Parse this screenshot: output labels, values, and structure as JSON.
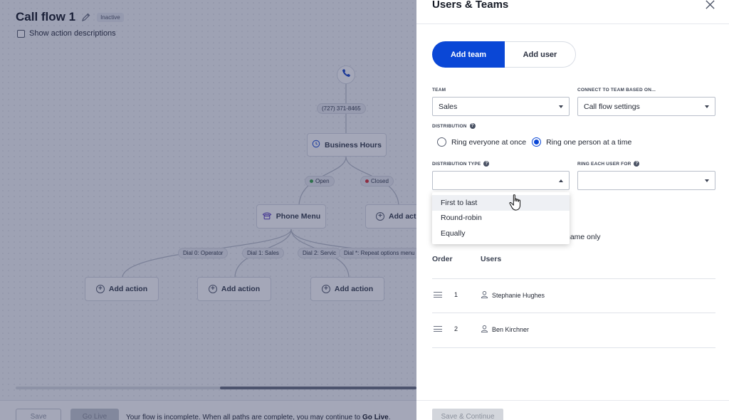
{
  "canvas": {
    "title": "Call flow 1",
    "status_badge": "Inactive",
    "show_descriptions_label": "Show action descriptions",
    "phone_number": "(727) 371-8465",
    "business_hours": "Business Hours",
    "branch_open": "Open",
    "branch_closed": "Closed",
    "phone_menu": "Phone Menu",
    "add_action_partial": "Add acti",
    "dial_options": [
      "Dial 0: Operator",
      "Dial 1: Sales",
      "Dial 2: Servic",
      "Dial *: Repeat options menu"
    ],
    "add_action": "Add action",
    "save_label": "Save",
    "go_live_label": "Go Live",
    "status_message_prefix": "Your flow is incomplete. When all paths are complete, you may continue to ",
    "status_message_link": "Go Live",
    "status_message_suffix": "."
  },
  "panel": {
    "title": "Users & Teams",
    "tabs": {
      "add_team": "Add team",
      "add_user": "Add user"
    },
    "team_label": "Team",
    "team_value": "Sales",
    "connect_label": "Connect to team based on...",
    "connect_value": "Call flow settings",
    "distribution_label": "Distribution",
    "distribution_options": [
      "Ring everyone at once",
      "Ring one person at a time"
    ],
    "distribution_type_label": "Distribution type",
    "distribution_type_value": "",
    "ring_each_label": "Ring each user for",
    "ring_each_value": "",
    "dropdown_options": [
      "First to last",
      "Round-robin",
      "Equally"
    ],
    "partial_option_text": "name only",
    "table": {
      "headers": {
        "order": "Order",
        "users": "Users"
      },
      "rows": [
        {
          "order": "1",
          "user": "Stephanie Hughes"
        },
        {
          "order": "2",
          "user": "Ben Kirchner"
        }
      ]
    },
    "save_continue": "Save & Continue"
  },
  "colors": {
    "primary": "#0a47d6",
    "phone_icon": "#1b47c9",
    "open_dot": "#3fa34d",
    "closed_dot": "#d9343b"
  }
}
